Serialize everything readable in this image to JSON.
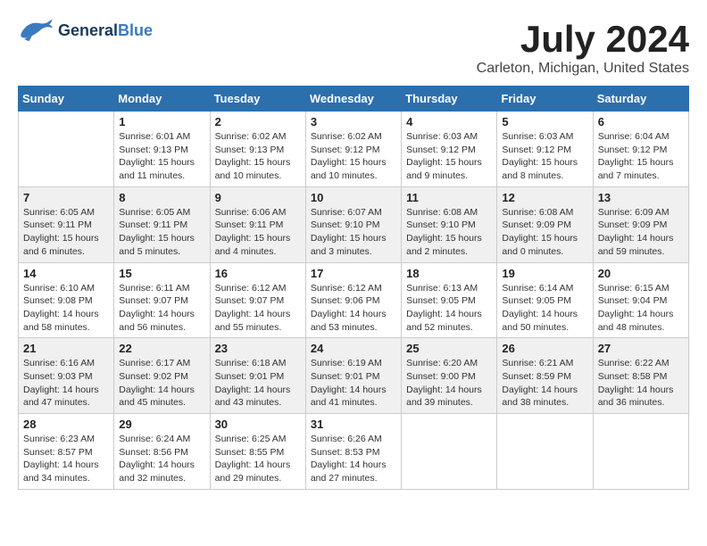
{
  "logo": {
    "text_general": "General",
    "text_blue": "Blue"
  },
  "title": {
    "month_year": "July 2024",
    "location": "Carleton, Michigan, United States"
  },
  "weekdays": [
    "Sunday",
    "Monday",
    "Tuesday",
    "Wednesday",
    "Thursday",
    "Friday",
    "Saturday"
  ],
  "weeks": [
    [
      {
        "day": "",
        "sunrise": "",
        "sunset": "",
        "daylight": ""
      },
      {
        "day": "1",
        "sunrise": "Sunrise: 6:01 AM",
        "sunset": "Sunset: 9:13 PM",
        "daylight": "Daylight: 15 hours and 11 minutes."
      },
      {
        "day": "2",
        "sunrise": "Sunrise: 6:02 AM",
        "sunset": "Sunset: 9:13 PM",
        "daylight": "Daylight: 15 hours and 10 minutes."
      },
      {
        "day": "3",
        "sunrise": "Sunrise: 6:02 AM",
        "sunset": "Sunset: 9:12 PM",
        "daylight": "Daylight: 15 hours and 10 minutes."
      },
      {
        "day": "4",
        "sunrise": "Sunrise: 6:03 AM",
        "sunset": "Sunset: 9:12 PM",
        "daylight": "Daylight: 15 hours and 9 minutes."
      },
      {
        "day": "5",
        "sunrise": "Sunrise: 6:03 AM",
        "sunset": "Sunset: 9:12 PM",
        "daylight": "Daylight: 15 hours and 8 minutes."
      },
      {
        "day": "6",
        "sunrise": "Sunrise: 6:04 AM",
        "sunset": "Sunset: 9:12 PM",
        "daylight": "Daylight: 15 hours and 7 minutes."
      }
    ],
    [
      {
        "day": "7",
        "sunrise": "Sunrise: 6:05 AM",
        "sunset": "Sunset: 9:11 PM",
        "daylight": "Daylight: 15 hours and 6 minutes."
      },
      {
        "day": "8",
        "sunrise": "Sunrise: 6:05 AM",
        "sunset": "Sunset: 9:11 PM",
        "daylight": "Daylight: 15 hours and 5 minutes."
      },
      {
        "day": "9",
        "sunrise": "Sunrise: 6:06 AM",
        "sunset": "Sunset: 9:11 PM",
        "daylight": "Daylight: 15 hours and 4 minutes."
      },
      {
        "day": "10",
        "sunrise": "Sunrise: 6:07 AM",
        "sunset": "Sunset: 9:10 PM",
        "daylight": "Daylight: 15 hours and 3 minutes."
      },
      {
        "day": "11",
        "sunrise": "Sunrise: 6:08 AM",
        "sunset": "Sunset: 9:10 PM",
        "daylight": "Daylight: 15 hours and 2 minutes."
      },
      {
        "day": "12",
        "sunrise": "Sunrise: 6:08 AM",
        "sunset": "Sunset: 9:09 PM",
        "daylight": "Daylight: 15 hours and 0 minutes."
      },
      {
        "day": "13",
        "sunrise": "Sunrise: 6:09 AM",
        "sunset": "Sunset: 9:09 PM",
        "daylight": "Daylight: 14 hours and 59 minutes."
      }
    ],
    [
      {
        "day": "14",
        "sunrise": "Sunrise: 6:10 AM",
        "sunset": "Sunset: 9:08 PM",
        "daylight": "Daylight: 14 hours and 58 minutes."
      },
      {
        "day": "15",
        "sunrise": "Sunrise: 6:11 AM",
        "sunset": "Sunset: 9:07 PM",
        "daylight": "Daylight: 14 hours and 56 minutes."
      },
      {
        "day": "16",
        "sunrise": "Sunrise: 6:12 AM",
        "sunset": "Sunset: 9:07 PM",
        "daylight": "Daylight: 14 hours and 55 minutes."
      },
      {
        "day": "17",
        "sunrise": "Sunrise: 6:12 AM",
        "sunset": "Sunset: 9:06 PM",
        "daylight": "Daylight: 14 hours and 53 minutes."
      },
      {
        "day": "18",
        "sunrise": "Sunrise: 6:13 AM",
        "sunset": "Sunset: 9:05 PM",
        "daylight": "Daylight: 14 hours and 52 minutes."
      },
      {
        "day": "19",
        "sunrise": "Sunrise: 6:14 AM",
        "sunset": "Sunset: 9:05 PM",
        "daylight": "Daylight: 14 hours and 50 minutes."
      },
      {
        "day": "20",
        "sunrise": "Sunrise: 6:15 AM",
        "sunset": "Sunset: 9:04 PM",
        "daylight": "Daylight: 14 hours and 48 minutes."
      }
    ],
    [
      {
        "day": "21",
        "sunrise": "Sunrise: 6:16 AM",
        "sunset": "Sunset: 9:03 PM",
        "daylight": "Daylight: 14 hours and 47 minutes."
      },
      {
        "day": "22",
        "sunrise": "Sunrise: 6:17 AM",
        "sunset": "Sunset: 9:02 PM",
        "daylight": "Daylight: 14 hours and 45 minutes."
      },
      {
        "day": "23",
        "sunrise": "Sunrise: 6:18 AM",
        "sunset": "Sunset: 9:01 PM",
        "daylight": "Daylight: 14 hours and 43 minutes."
      },
      {
        "day": "24",
        "sunrise": "Sunrise: 6:19 AM",
        "sunset": "Sunset: 9:01 PM",
        "daylight": "Daylight: 14 hours and 41 minutes."
      },
      {
        "day": "25",
        "sunrise": "Sunrise: 6:20 AM",
        "sunset": "Sunset: 9:00 PM",
        "daylight": "Daylight: 14 hours and 39 minutes."
      },
      {
        "day": "26",
        "sunrise": "Sunrise: 6:21 AM",
        "sunset": "Sunset: 8:59 PM",
        "daylight": "Daylight: 14 hours and 38 minutes."
      },
      {
        "day": "27",
        "sunrise": "Sunrise: 6:22 AM",
        "sunset": "Sunset: 8:58 PM",
        "daylight": "Daylight: 14 hours and 36 minutes."
      }
    ],
    [
      {
        "day": "28",
        "sunrise": "Sunrise: 6:23 AM",
        "sunset": "Sunset: 8:57 PM",
        "daylight": "Daylight: 14 hours and 34 minutes."
      },
      {
        "day": "29",
        "sunrise": "Sunrise: 6:24 AM",
        "sunset": "Sunset: 8:56 PM",
        "daylight": "Daylight: 14 hours and 32 minutes."
      },
      {
        "day": "30",
        "sunrise": "Sunrise: 6:25 AM",
        "sunset": "Sunset: 8:55 PM",
        "daylight": "Daylight: 14 hours and 29 minutes."
      },
      {
        "day": "31",
        "sunrise": "Sunrise: 6:26 AM",
        "sunset": "Sunset: 8:53 PM",
        "daylight": "Daylight: 14 hours and 27 minutes."
      },
      {
        "day": "",
        "sunrise": "",
        "sunset": "",
        "daylight": ""
      },
      {
        "day": "",
        "sunrise": "",
        "sunset": "",
        "daylight": ""
      },
      {
        "day": "",
        "sunrise": "",
        "sunset": "",
        "daylight": ""
      }
    ]
  ]
}
